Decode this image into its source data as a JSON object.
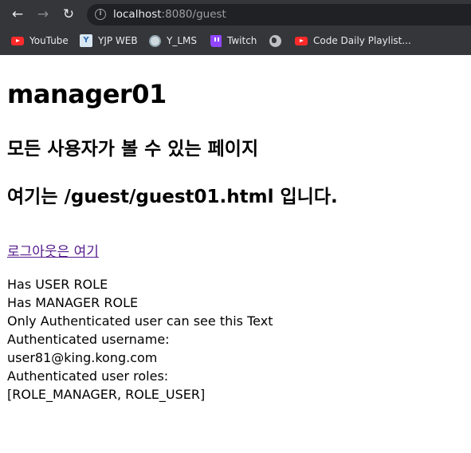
{
  "browser": {
    "url_host": "localhost",
    "url_rest": ":8080/guest",
    "bookmarks": [
      {
        "label": "YouTube",
        "icon": "youtube-icon"
      },
      {
        "label": "YJP WEB",
        "icon": "yjp-icon"
      },
      {
        "label": "Y_LMS",
        "icon": "ylms-icon"
      },
      {
        "label": "Twitch",
        "icon": "twitch-icon"
      },
      {
        "label": "",
        "icon": "globe-icon"
      },
      {
        "label": "Code Daily Playlist...",
        "icon": "youtube-icon"
      }
    ]
  },
  "page": {
    "heading": "manager01",
    "subheading1": "모든 사용자가 볼 수 있는 페이지",
    "subheading2": "여기는 /guest/guest01.html 입니다.",
    "logout_link": "로그아웃은 여기",
    "lines": [
      "Has USER ROLE",
      "Has MANAGER ROLE",
      "Only Authenticated user can see this Text",
      "Authenticated username:",
      "user81@king.kong.com",
      "Authenticated user roles:",
      "[ROLE_MANAGER, ROLE_USER]"
    ]
  }
}
